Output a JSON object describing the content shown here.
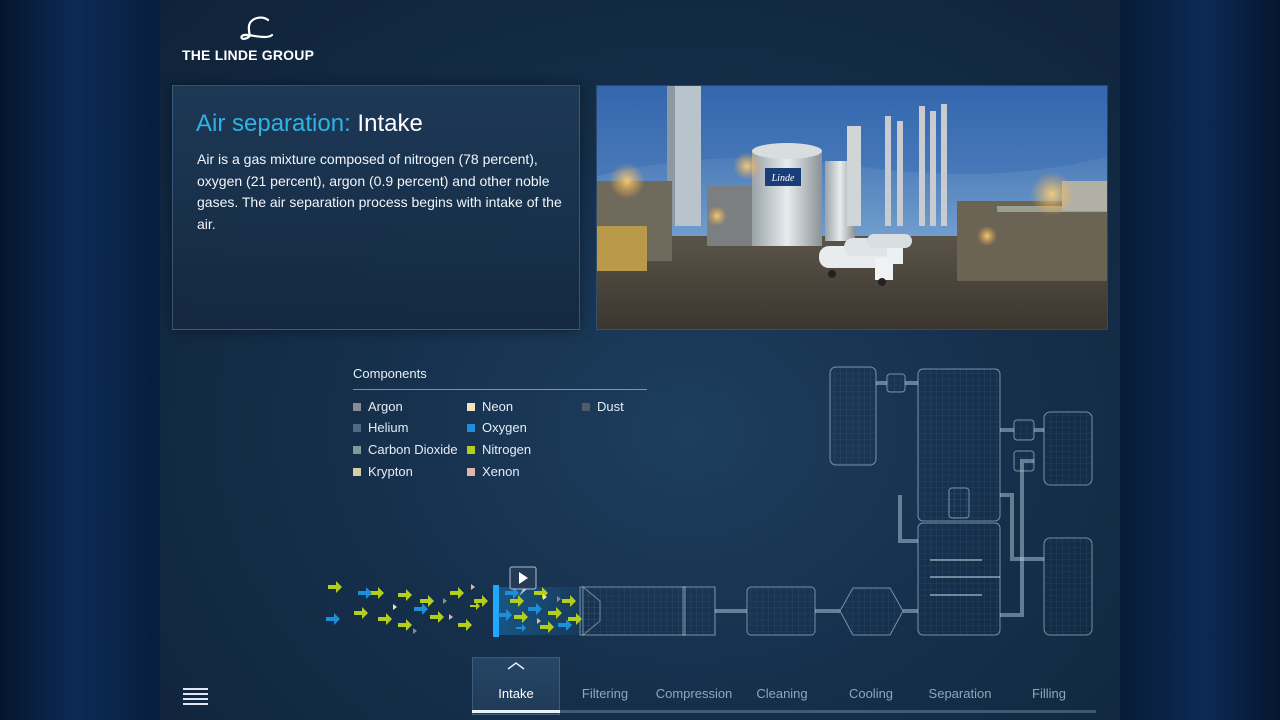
{
  "brand": {
    "logo_text": "THE LINDE GROUP"
  },
  "info": {
    "title_prefix": "Air separation:",
    "title_step": "Intake",
    "body": "Air is a gas mixture composed of nitrogen (78 percent), oxygen (21 percent), argon (0.9 percent) and other noble gases. The air separation process begins with intake of the air."
  },
  "photo": {
    "sign_text": "Linde"
  },
  "legend": {
    "title": "Components",
    "items": [
      {
        "label": "Argon",
        "color": "#8a8a92"
      },
      {
        "label": "Helium",
        "color": "#4e6a86"
      },
      {
        "label": "Carbon Dioxide",
        "color": "#7f9a98"
      },
      {
        "label": "Krypton",
        "color": "#d3d0a8"
      },
      {
        "label": "Neon",
        "color": "#f1e3bf"
      },
      {
        "label": "Oxygen",
        "color": "#1e8fd6"
      },
      {
        "label": "Nitrogen",
        "color": "#b3ce1d"
      },
      {
        "label": "Xenon",
        "color": "#e0b6aa"
      },
      {
        "label": "Dust",
        "color": "#4f5a6a"
      }
    ]
  },
  "tabs": [
    {
      "label": "Intake",
      "active": true
    },
    {
      "label": "Filtering",
      "active": false
    },
    {
      "label": "Compression",
      "active": false
    },
    {
      "label": "Cleaning",
      "active": false
    },
    {
      "label": "Cooling",
      "active": false
    },
    {
      "label": "Separation",
      "active": false
    },
    {
      "label": "Filling",
      "active": false
    }
  ],
  "icons": {
    "menu": "hamburger-menu-icon",
    "play": "play-icon",
    "chevron": "chevron-up-icon"
  }
}
